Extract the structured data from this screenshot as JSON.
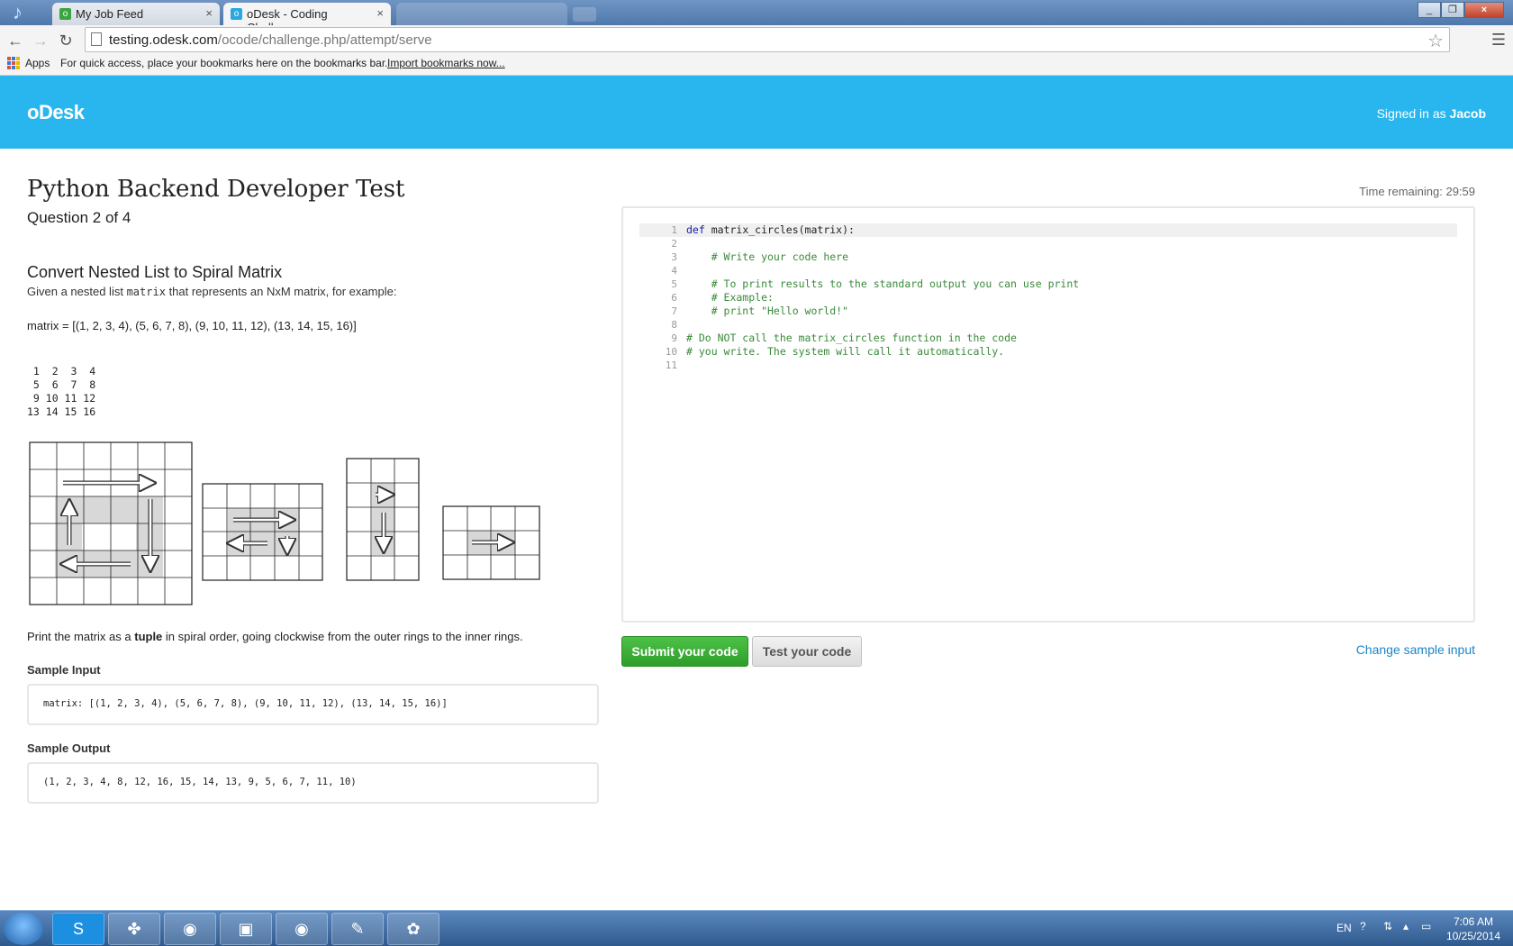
{
  "browser": {
    "tabs": [
      {
        "label": "My Job Feed"
      },
      {
        "label": "oDesk - Coding Challenge"
      }
    ],
    "url_domain": "testing.odesk.com",
    "url_path": "/ocode/challenge.php/attempt/serve",
    "bookmarks": {
      "apps": "Apps",
      "message": "For quick access, place your bookmarks here on the bookmarks bar.",
      "import_link": "Import bookmarks now..."
    }
  },
  "header": {
    "logo": "oDesk",
    "signed_prefix": "Signed in as",
    "user": "Jacob"
  },
  "test": {
    "title": "Python Backend Developer Test",
    "question": "Question 2 of 4",
    "time_remaining": "Time remaining: 29:59"
  },
  "problem": {
    "title": "Convert Nested List to Spiral Matrix",
    "desc_before": "Given a nested list",
    "desc_code": "matrix",
    "desc_after": "that represents an NxM matrix, for example:",
    "example": "matrix = [(1, 2, 3, 4), (5, 6, 7, 8), (9, 10, 11, 12), (13, 14, 15, 16)]",
    "matrix_display": " 1  2  3  4\n 5  6  7  8\n 9 10 11 12\n13 14 15 16",
    "print_before": "Print the matrix as a",
    "print_bold": "tuple",
    "print_after": "in spiral order, going clockwise from the outer rings to the inner rings.",
    "sample_input_label": "Sample Input",
    "sample_input": "matrix: [(1, 2, 3, 4), (5, 6, 7, 8), (9, 10, 11, 12), (13, 14, 15, 16)]",
    "sample_output_label": "Sample Output",
    "sample_output": "(1, 2, 3, 4, 8, 12, 16, 15, 14, 13, 9, 5, 6, 7, 11, 10)"
  },
  "editor": {
    "lines": [
      {
        "n": "1",
        "kw": "def",
        "text": " matrix_circles(matrix):",
        "comment": false
      },
      {
        "n": "2",
        "kw": "",
        "text": "",
        "comment": false
      },
      {
        "n": "3",
        "kw": "",
        "text": "    # Write your code here",
        "comment": true
      },
      {
        "n": "4",
        "kw": "",
        "text": "",
        "comment": false
      },
      {
        "n": "5",
        "kw": "",
        "text": "    # To print results to the standard output you can use print",
        "comment": true
      },
      {
        "n": "6",
        "kw": "",
        "text": "    # Example:",
        "comment": true
      },
      {
        "n": "7",
        "kw": "",
        "text": "    # print \"Hello world!\"",
        "comment": true
      },
      {
        "n": "8",
        "kw": "",
        "text": "",
        "comment": false
      },
      {
        "n": "9",
        "kw": "",
        "text": "# Do NOT call the matrix_circles function in the code",
        "comment": true
      },
      {
        "n": "10",
        "kw": "",
        "text": "# you write. The system will call it automatically.",
        "comment": true
      },
      {
        "n": "11",
        "kw": "",
        "text": "",
        "comment": false
      }
    ]
  },
  "actions": {
    "submit": "Submit your code",
    "test": "Test your code",
    "change_input": "Change sample input"
  },
  "taskbar": {
    "lang": "EN",
    "time": "7:06 AM",
    "date": "10/25/2014"
  }
}
